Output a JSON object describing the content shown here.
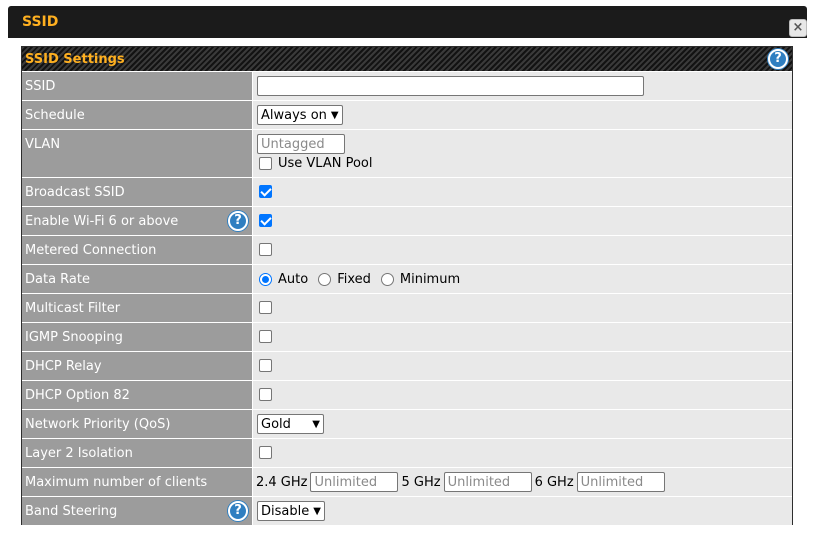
{
  "dialog": {
    "title": "SSID",
    "close_glyph": "×"
  },
  "section": {
    "title": "SSID Settings",
    "help_glyph": "?"
  },
  "rows": {
    "ssid": {
      "label": "SSID",
      "value": ""
    },
    "schedule": {
      "label": "Schedule",
      "value": "Always on"
    },
    "vlan": {
      "label": "VLAN",
      "placeholder": "Untagged",
      "pool_label": "Use VLAN Pool",
      "pool_checked": false
    },
    "broadcast": {
      "label": "Broadcast SSID",
      "checked": true
    },
    "wifi6": {
      "label": "Enable Wi-Fi 6 or above",
      "checked": true
    },
    "metered": {
      "label": "Metered Connection",
      "checked": false
    },
    "data_rate": {
      "label": "Data Rate",
      "options": [
        "Auto",
        "Fixed",
        "Minimum"
      ],
      "selected": "Auto"
    },
    "multicast": {
      "label": "Multicast Filter",
      "checked": false
    },
    "igmp": {
      "label": "IGMP Snooping",
      "checked": false
    },
    "dhcp_relay": {
      "label": "DHCP Relay",
      "checked": false
    },
    "dhcp82": {
      "label": "DHCP Option 82",
      "checked": false
    },
    "qos": {
      "label": "Network Priority (QoS)",
      "value": "Gold"
    },
    "layer2": {
      "label": "Layer 2 Isolation",
      "checked": false
    },
    "max_clients": {
      "label": "Maximum number of clients",
      "band_24": "2.4 GHz",
      "band_5": "5 GHz",
      "band_6": "6 GHz",
      "placeholder": "Unlimited"
    },
    "band_steering": {
      "label": "Band Steering",
      "value": "Disable"
    }
  },
  "icons": {
    "help": "help-circle-icon",
    "close": "close-icon",
    "dropdown": "chevron-down-icon"
  },
  "colors": {
    "accent": "#ffb020",
    "label_bg": "#9c9c9c",
    "value_bg": "#e9e9e9",
    "checkbox": "#0075ff",
    "help": "#2f7fc1"
  }
}
